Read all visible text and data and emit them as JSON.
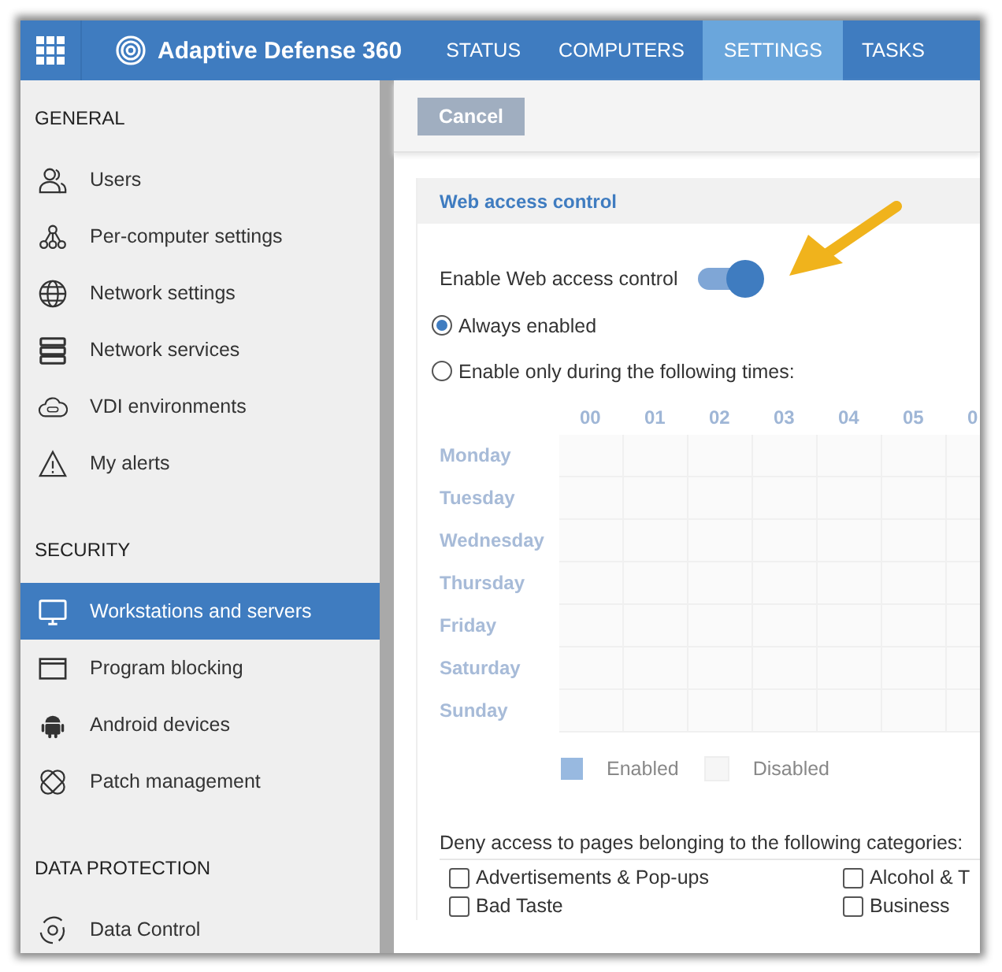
{
  "header": {
    "app_title": "Adaptive Defense 360",
    "tabs": [
      {
        "label": "STATUS",
        "selected": false
      },
      {
        "label": "COMPUTERS",
        "selected": false
      },
      {
        "label": "SETTINGS",
        "selected": true
      },
      {
        "label": "TASKS",
        "selected": false
      }
    ]
  },
  "toolbar": {
    "cancel_button": "Cancel"
  },
  "sidebar": {
    "sections": [
      {
        "title": "GENERAL",
        "items": [
          {
            "label": "Users",
            "kind": "users",
            "selected": false
          },
          {
            "label": "Per-computer settings",
            "kind": "nodes",
            "selected": false
          },
          {
            "label": "Network settings",
            "kind": "globe",
            "selected": false
          },
          {
            "label": "Network services",
            "kind": "server",
            "selected": false
          },
          {
            "label": "VDI environments",
            "kind": "cloud",
            "selected": false
          },
          {
            "label": "My alerts",
            "kind": "alert",
            "selected": false
          }
        ]
      },
      {
        "title": "SECURITY",
        "items": [
          {
            "label": "Workstations and servers",
            "kind": "monitor",
            "selected": true
          },
          {
            "label": "Program blocking",
            "kind": "window",
            "selected": false
          },
          {
            "label": "Android devices",
            "kind": "android",
            "selected": false
          },
          {
            "label": "Patch management",
            "kind": "patch",
            "selected": false
          }
        ]
      },
      {
        "title": "DATA PROTECTION",
        "items": [
          {
            "label": "Data Control",
            "kind": "data",
            "selected": false
          }
        ]
      }
    ]
  },
  "panel": {
    "title": "Web access control",
    "enable_label": "Enable Web access control",
    "enabled": true,
    "radios": [
      {
        "label": "Always enabled",
        "selected": true
      },
      {
        "label": "Enable only during the following times:",
        "selected": false
      }
    ],
    "schedule": {
      "hours": [
        "00",
        "01",
        "02",
        "03",
        "04",
        "05",
        "0"
      ],
      "days": [
        "Monday",
        "Tuesday",
        "Wednesday",
        "Thursday",
        "Friday",
        "Saturday",
        "Sunday"
      ]
    },
    "legend": [
      {
        "label": "Enabled",
        "kind": "enabled"
      },
      {
        "label": "Disabled",
        "kind": "disabled"
      }
    ],
    "categories_label": "Deny access to pages belonging to the following categories:",
    "categories": [
      {
        "label": "Advertisements & Pop-ups",
        "checked": false
      },
      {
        "label": "Alcohol & T",
        "checked": false
      },
      {
        "label": "Bad Taste",
        "checked": false
      },
      {
        "label": "Business",
        "checked": false
      }
    ]
  }
}
